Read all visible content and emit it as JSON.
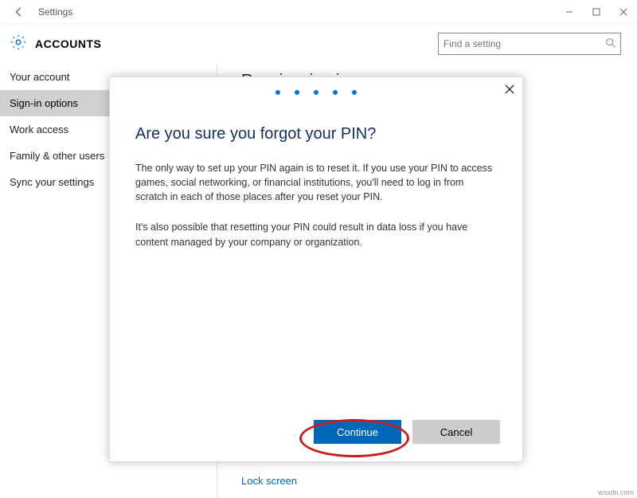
{
  "window": {
    "title": "Settings"
  },
  "header": {
    "page_title": "ACCOUNTS",
    "search_placeholder": "Find a setting"
  },
  "sidebar": {
    "items": [
      {
        "label": "Your account"
      },
      {
        "label": "Sign-in options"
      },
      {
        "label": "Work access"
      },
      {
        "label": "Family & other users"
      },
      {
        "label": "Sync your settings"
      }
    ],
    "active_index": 1
  },
  "content": {
    "section_heading": "Require sign-in",
    "lock_screen_link": "Lock screen"
  },
  "dialog": {
    "title": "Are you sure you forgot your PIN?",
    "para1": "The only way to set up your PIN again is to reset it. If you use your PIN to access games, social networking, or financial institutions, you'll need to log in from scratch in each of those places after you reset your PIN.",
    "para2": "It's also possible that resetting your PIN could result in data loss if you have content managed by your company or organization.",
    "continue": "Continue",
    "cancel": "Cancel"
  },
  "watermark": "wsxdn.com"
}
